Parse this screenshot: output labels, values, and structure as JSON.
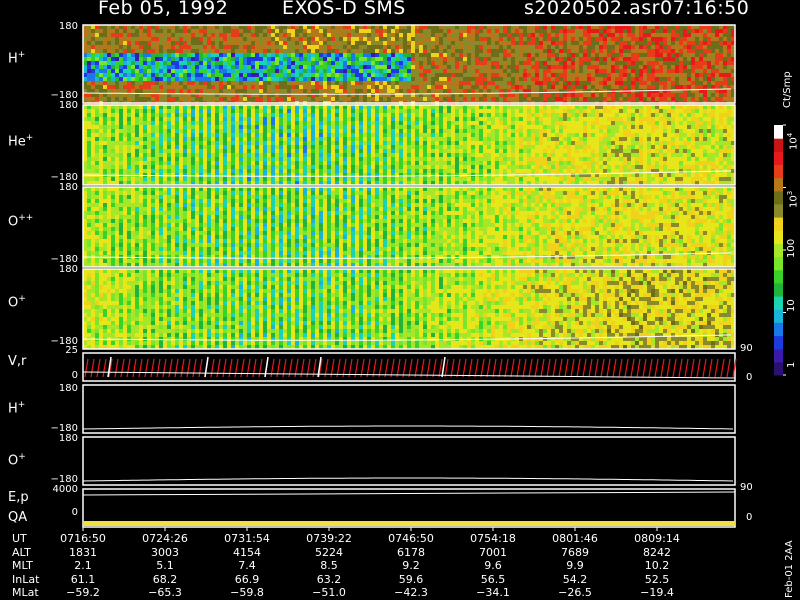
{
  "header": {
    "date": "Feb 05, 1992",
    "instrument": "EXOS-D SMS",
    "file": "s2020502.asr",
    "time": "07:16:50"
  },
  "panels": [
    {
      "id": "h",
      "label": "H",
      "sup": "+",
      "ymax": "180",
      "ymin": "−180"
    },
    {
      "id": "he",
      "label": "He",
      "sup": "+",
      "ymax": "180",
      "ymin": "−180"
    },
    {
      "id": "opp",
      "label": "O",
      "sup": "++",
      "ymax": "180",
      "ymin": "−180"
    },
    {
      "id": "op",
      "label": "O",
      "sup": "+",
      "ymax": "180",
      "ymin": "−180"
    }
  ],
  "vr_panel": {
    "label": "V,r",
    "ymax": "25",
    "ymin": "0",
    "right_top": "90",
    "right_bottom": "0"
  },
  "h2_panel": {
    "label": "H",
    "sup": "+",
    "ymax": "180",
    "ymin": "−180"
  },
  "o2_panel": {
    "label": "O",
    "sup": "+",
    "ymax": "180",
    "ymin": "−180"
  },
  "ep_panel": {
    "label": "E,p",
    "ymax": "4000",
    "right_top": "90"
  },
  "qa_panel": {
    "label": "QA",
    "ymin": "0",
    "right_bottom": "0"
  },
  "colorbar": {
    "unit": "Ct/Smp",
    "ticks": [
      {
        "base": "10",
        "exp": "4",
        "log": 4
      },
      {
        "base": "10",
        "exp": "3",
        "log": 3
      },
      {
        "base": "100",
        "exp": "",
        "log": 2
      },
      {
        "base": "10",
        "exp": "",
        "log": 1
      },
      {
        "base": "1",
        "exp": "",
        "log": 0
      }
    ],
    "colors": [
      "#2a1070",
      "#3a1aa8",
      "#1e3adc",
      "#1a78e8",
      "#1ab4d8",
      "#1ad2b4",
      "#22b43a",
      "#38d22a",
      "#78e62a",
      "#a8e62a",
      "#e6e61a",
      "#f0d21a",
      "#8a8a2a",
      "#6e6e1a",
      "#b4781a",
      "#e63c1a",
      "#e61a1a",
      "#c81414",
      "#ffffff"
    ]
  },
  "table": {
    "rows": [
      {
        "label": "UT",
        "values": [
          "0716:50",
          "0724:26",
          "0731:54",
          "0739:22",
          "0746:50",
          "0754:18",
          "0801:46",
          "0809:14"
        ]
      },
      {
        "label": "ALT",
        "values": [
          "1831",
          "3003",
          "4154",
          "5224",
          "6178",
          "7001",
          "7689",
          "8242"
        ]
      },
      {
        "label": "MLT",
        "values": [
          "2.1",
          "5.1",
          "7.4",
          "8.5",
          "9.2",
          "9.6",
          "9.9",
          "10.2"
        ]
      },
      {
        "label": "InLat",
        "values": [
          "61.1",
          "68.2",
          "66.9",
          "63.2",
          "59.6",
          "56.5",
          "54.2",
          "52.5"
        ]
      },
      {
        "label": "MLat",
        "values": [
          "−59.2",
          "−65.3",
          "−59.8",
          "−51.0",
          "−42.3",
          "−34.1",
          "−26.5",
          "−19.4"
        ]
      }
    ]
  },
  "side_note": "Feb-01 2AA",
  "chart_data": {
    "type": "heatmap",
    "x": [
      "0716:50",
      "0724:26",
      "0731:54",
      "0739:22",
      "0746:50",
      "0754:18",
      "0801:46",
      "0809:14"
    ],
    "spectrogram_panels": [
      "H+",
      "He+",
      "O++",
      "O+"
    ],
    "ylim": [
      -180,
      180
    ],
    "colorbar_range_log10": [
      0,
      4
    ],
    "typical_level_log10": {
      "H+": [
        3.1,
        3.2,
        3.1,
        3.0,
        3.1,
        3.3,
        3.4,
        3.3
      ],
      "He+": [
        2.0,
        1.4,
        1.2,
        1.3,
        1.8,
        2.3,
        2.4,
        2.3
      ],
      "O++": [
        2.0,
        1.5,
        1.3,
        1.4,
        1.9,
        2.3,
        2.4,
        2.3
      ],
      "O+": [
        2.2,
        1.6,
        1.4,
        1.5,
        2.0,
        2.4,
        2.6,
        2.5
      ]
    }
  }
}
